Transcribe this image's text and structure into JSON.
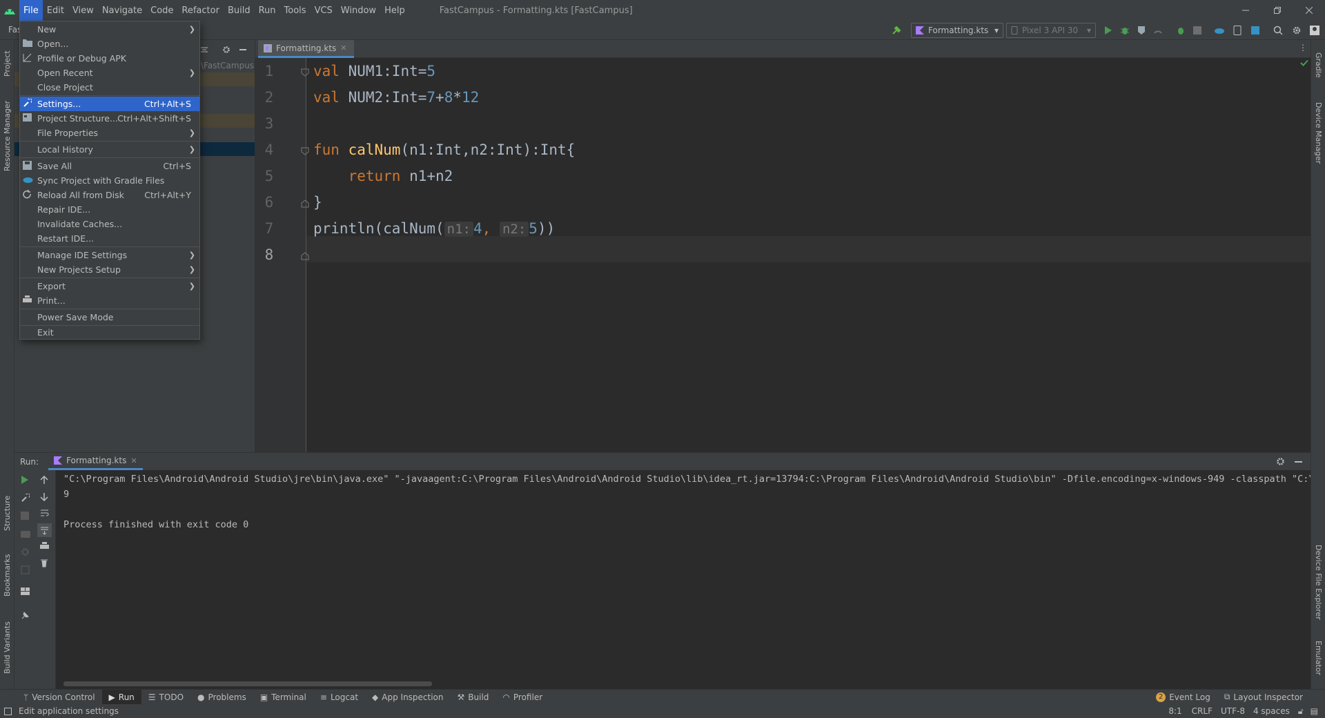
{
  "titlebar": {
    "menu": [
      "File",
      "Edit",
      "View",
      "Navigate",
      "Code",
      "Refactor",
      "Build",
      "Run",
      "Tools",
      "VCS",
      "Window",
      "Help"
    ],
    "window_title": "FastCampus - Formatting.kts [FastCampus]"
  },
  "toolbar": {
    "project_name_fragment": "Fas",
    "run_config": "Formatting.kts",
    "device": "Pixel 3 API 30"
  },
  "project_panel": {
    "path_fragment": "\\FastCampus"
  },
  "file_menu": {
    "items": [
      {
        "label": "New",
        "shortcut": "",
        "submenu": true
      },
      {
        "label": "Open...",
        "shortcut": "",
        "submenu": false
      },
      {
        "label": "Profile or Debug APK",
        "shortcut": "",
        "submenu": false
      },
      {
        "label": "Open Recent",
        "shortcut": "",
        "submenu": true
      },
      {
        "label": "Close Project",
        "shortcut": "",
        "submenu": false
      },
      {
        "label": "Settings...",
        "shortcut": "Ctrl+Alt+S",
        "submenu": false,
        "selected": true
      },
      {
        "label": "Project Structure...",
        "shortcut": "Ctrl+Alt+Shift+S",
        "submenu": false
      },
      {
        "label": "File Properties",
        "shortcut": "",
        "submenu": true
      },
      {
        "label": "Local History",
        "shortcut": "",
        "submenu": true
      },
      {
        "label": "Save All",
        "shortcut": "Ctrl+S",
        "submenu": false
      },
      {
        "label": "Sync Project with Gradle Files",
        "shortcut": "",
        "submenu": false
      },
      {
        "label": "Reload All from Disk",
        "shortcut": "Ctrl+Alt+Y",
        "submenu": false
      },
      {
        "label": "Repair IDE...",
        "shortcut": "",
        "submenu": false
      },
      {
        "label": "Invalidate Caches...",
        "shortcut": "",
        "submenu": false
      },
      {
        "label": "Restart IDE...",
        "shortcut": "",
        "submenu": false
      },
      {
        "label": "Manage IDE Settings",
        "shortcut": "",
        "submenu": true
      },
      {
        "label": "New Projects Setup",
        "shortcut": "",
        "submenu": true
      },
      {
        "label": "Export",
        "shortcut": "",
        "submenu": true
      },
      {
        "label": "Print...",
        "shortcut": "",
        "submenu": false
      },
      {
        "label": "Power Save Mode",
        "shortcut": "",
        "submenu": false
      },
      {
        "label": "Exit",
        "shortcut": "",
        "submenu": false
      }
    ]
  },
  "editor": {
    "tab": "Formatting.kts",
    "line_numbers": [
      "1",
      "2",
      "3",
      "4",
      "5",
      "6",
      "7",
      "8"
    ],
    "lines": {
      "l1": {
        "kw": "val",
        "name": " NUM1:Int=",
        "num": "5"
      },
      "l2": {
        "kw": "val",
        "name": " NUM2:Int=",
        "num_a": "7",
        "op_a": "+",
        "num_b": "8",
        "op_b": "*",
        "num_c": "12"
      },
      "l4": {
        "kw": "fun",
        "fn": "calNum",
        "rest": "(n1:Int,n2:Int):Int{"
      },
      "l5": {
        "kw": "return",
        "rest": " n1+n2"
      },
      "l6": {
        "rest": "}"
      },
      "l7": {
        "pre": "println(calNum(",
        "hint1": "n1:",
        "arg1": "4",
        "comma": ", ",
        "hint2": "n2:",
        "arg2": "5",
        "post": "))"
      }
    }
  },
  "run_panel": {
    "label": "Run:",
    "tab": "Formatting.kts",
    "console": [
      "\"C:\\Program Files\\Android\\Android Studio\\jre\\bin\\java.exe\" \"-javaagent:C:\\Program Files\\Android\\Android Studio\\lib\\idea_rt.jar=13794:C:\\Program Files\\Android\\Android Studio\\bin\" -Dfile.encoding=x-windows-949 -classpath \"C:\\Pro",
      "9",
      "",
      "Process finished with exit code 0"
    ]
  },
  "left_stripe": {
    "project": "Project",
    "resource_manager": "Resource Manager",
    "structure": "Structure",
    "bookmarks": "Bookmarks",
    "build_variants": "Build Variants"
  },
  "right_stripe": {
    "gradle": "Gradle",
    "device_manager": "Device Manager",
    "device_file_explorer": "Device File Explorer",
    "emulator": "Emulator"
  },
  "bottom_tabs": [
    "Version Control",
    "Run",
    "TODO",
    "Problems",
    "Terminal",
    "Logcat",
    "App Inspection",
    "Build",
    "Profiler"
  ],
  "bottom_right": {
    "event_log": "Event Log",
    "event_count": "2",
    "layout_inspector": "Layout Inspector"
  },
  "status": {
    "message": "Edit application settings",
    "position": "8:1",
    "line_sep": "CRLF",
    "encoding": "UTF-8",
    "indent": "4 spaces"
  },
  "colors": {
    "accent": "#2f65ca",
    "keyword": "#cc7832",
    "number": "#6897bb",
    "function": "#ffc66d"
  }
}
